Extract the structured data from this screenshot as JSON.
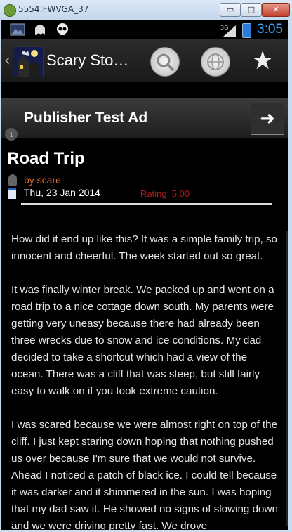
{
  "window": {
    "title": "5554:FWVGA_37",
    "min_label": "▭",
    "max_label": "□",
    "close_label": "✕"
  },
  "status": {
    "network": "3G",
    "clock": "3:05"
  },
  "actionbar": {
    "title": "Scary Sto…",
    "back": "‹"
  },
  "ad": {
    "text": "Publisher Test Ad",
    "arrow": "➜",
    "info": "i"
  },
  "story": {
    "title": "Road Trip",
    "author": "by scare",
    "date": "Thu, 23 Jan 2014",
    "rating": "Rating: 5.00"
  },
  "body": {
    "paragraphs": [
      "How did it end up like this? It was a simple family trip, so innocent and cheerful. The week started out so great.",
      "It was finally winter break. We packed up and went on a road trip to a nice cottage down south. My parents were getting very uneasy because there had already been three wrecks due to snow and ice conditions. My dad decided to take a shortcut which had a view of the ocean. There was a cliff that was steep, but still fairly easy to walk on if you took extreme caution.",
      "I was scared because we were almost right on top of the cliff. I just kept staring down hoping that nothing pushed us over because I'm sure that we would not survive. Ahead I noticed a patch of black ice. I could tell because it was darker and it shimmered in the sun. I was hoping that my dad saw it. He showed no signs of slowing down and we were driving pretty fast. We drove"
    ]
  },
  "colors": {
    "author": "#e0692c",
    "rating": "#b11b1b",
    "clock": "#3aa6ff"
  }
}
